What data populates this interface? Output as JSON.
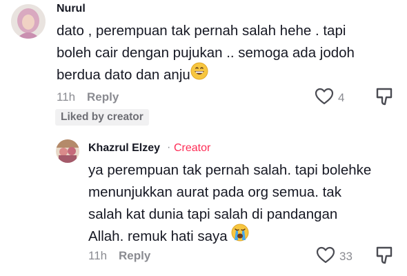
{
  "comment": {
    "author": "Nurul",
    "lines": [
      "dato , perempuan tak pernah salah hehe . tapi",
      "boleh cair dengan pujukan .. semoga ada jodoh",
      "berdua dato dan anju"
    ],
    "emoji": "grinning-face-emoji",
    "time": "11h",
    "reply_label": "Reply",
    "likes": "4",
    "liked_badge": "Liked by creator"
  },
  "reply_comment": {
    "author": "Khazrul Elzey",
    "separator": "·",
    "creator_label": "Creator",
    "lines": [
      "ya perempuan tak pernah salah. tapi bolehke",
      "menunjukkan aurat pada org semua. tak",
      "salah kat dunia tapi salah di pandangan",
      "Allah. remuk hati saya"
    ],
    "emoji": "crying-face-emoji",
    "time": "11h",
    "reply_label": "Reply",
    "likes": "33"
  },
  "colors": {
    "accent": "#fe2c55",
    "muted": "#8a8b91",
    "text": "#161823"
  }
}
